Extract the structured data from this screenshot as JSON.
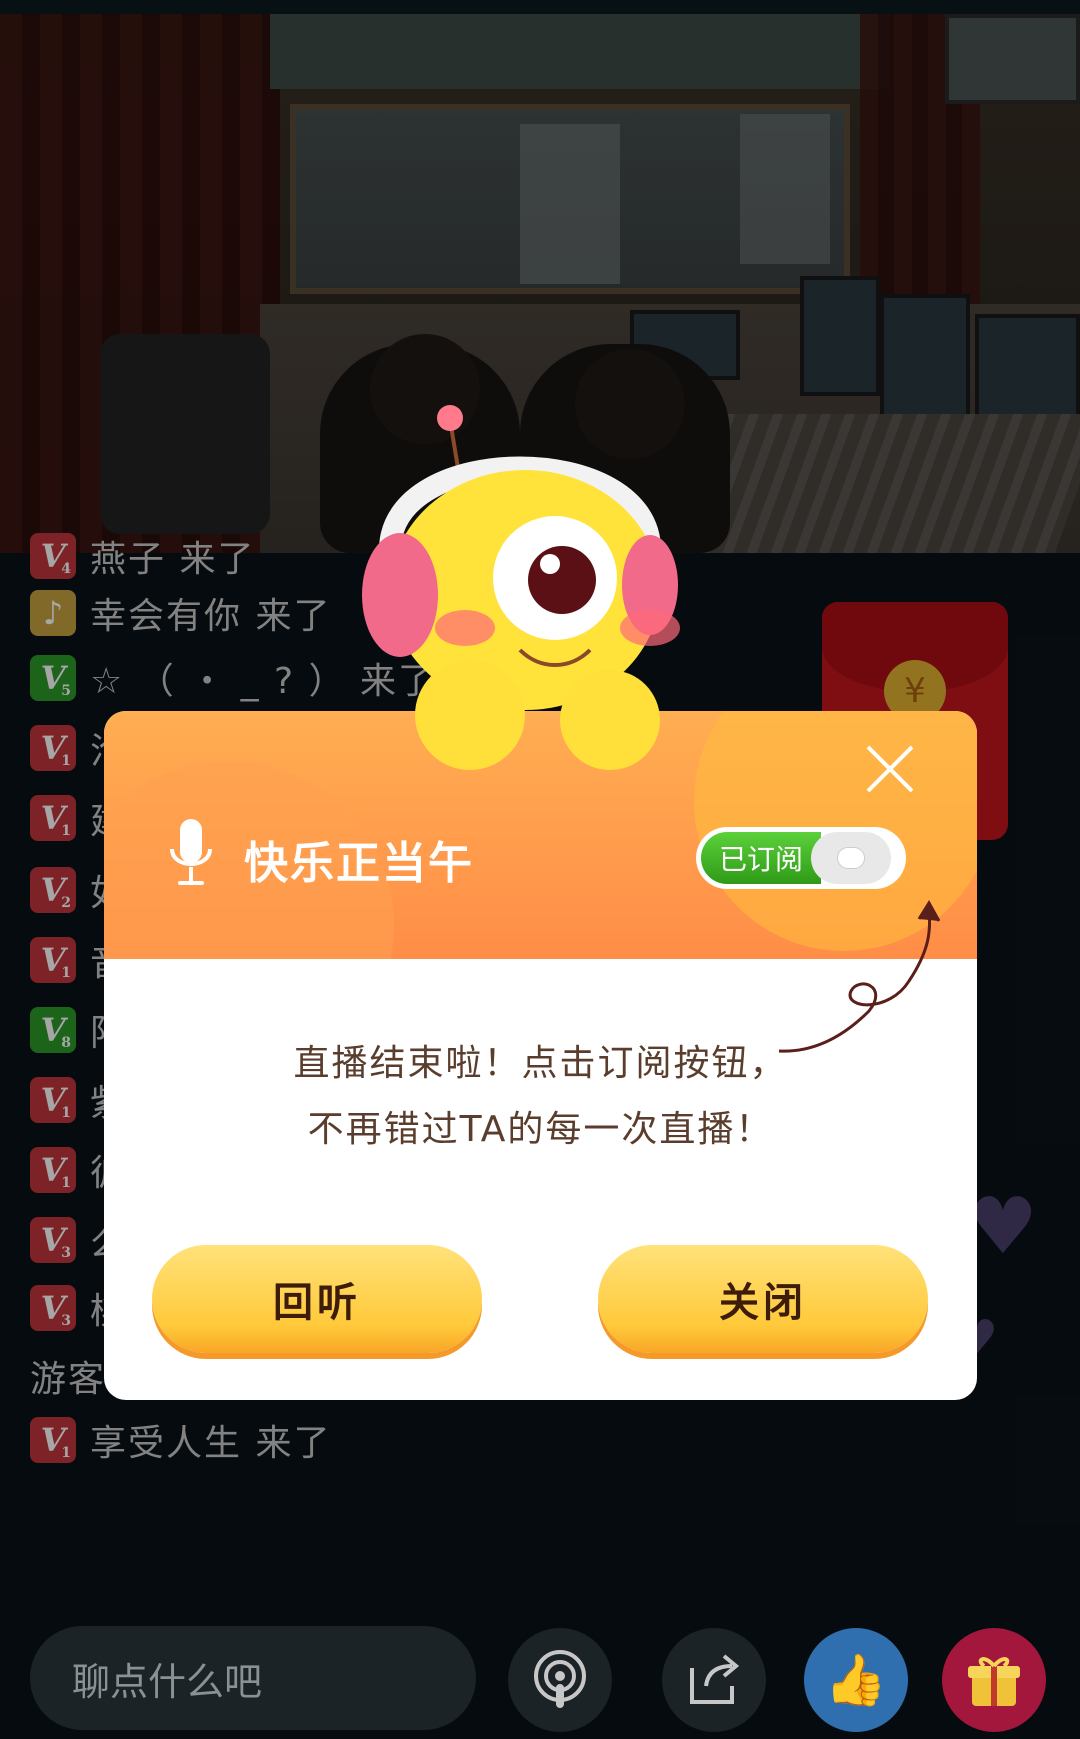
{
  "chat": {
    "messages": [
      {
        "badge": "V",
        "level": "4",
        "color": "red",
        "text": "燕子 来了",
        "top": 0
      },
      {
        "badge": "♪",
        "level": "",
        "color": "gold",
        "text": "幸会有你 来了"
      },
      {
        "badge": "V",
        "level": "5",
        "color": "green",
        "text": "☆ （ ・ _ ? ） 来了"
      },
      {
        "badge": "V",
        "level": "1",
        "color": "red",
        "text": "沧"
      },
      {
        "badge": "V",
        "level": "1",
        "color": "red",
        "text": "建"
      },
      {
        "badge": "V",
        "level": "2",
        "color": "red",
        "text": "如"
      },
      {
        "badge": "V",
        "level": "1",
        "color": "red",
        "text": "音"
      },
      {
        "badge": "V",
        "level": "8",
        "color": "green",
        "text": "阳"
      },
      {
        "badge": "V",
        "level": "1",
        "color": "red",
        "text": "紫"
      },
      {
        "badge": "V",
        "level": "1",
        "color": "red",
        "text": "彼"
      },
      {
        "badge": "V",
        "level": "3",
        "color": "red",
        "text": "么"
      },
      {
        "badge": "V",
        "level": "3",
        "color": "red",
        "text": "桃子 来了"
      },
      {
        "badge": "",
        "level": "",
        "color": "none",
        "text": "游客 来了"
      },
      {
        "badge": "V",
        "level": "1",
        "color": "red",
        "text": "享受人生 来了"
      }
    ]
  },
  "redpacket": {
    "symbol": "¥"
  },
  "modal": {
    "channel_name": "快乐正当午",
    "subscribe_label": "已订阅",
    "message_line1": "直播结束啦！点击订阅按钮，",
    "message_line2": "不再错过TA的每一次直播！",
    "replay_label": "回听",
    "close_label": "关闭"
  },
  "bottom_bar": {
    "input_placeholder": "聊点什么吧"
  },
  "colors": {
    "header_orange": "#ff8d47",
    "button_yellow": "#ffc93a",
    "subscribe_green": "#3fb020",
    "badge_red": "#c0353c"
  }
}
